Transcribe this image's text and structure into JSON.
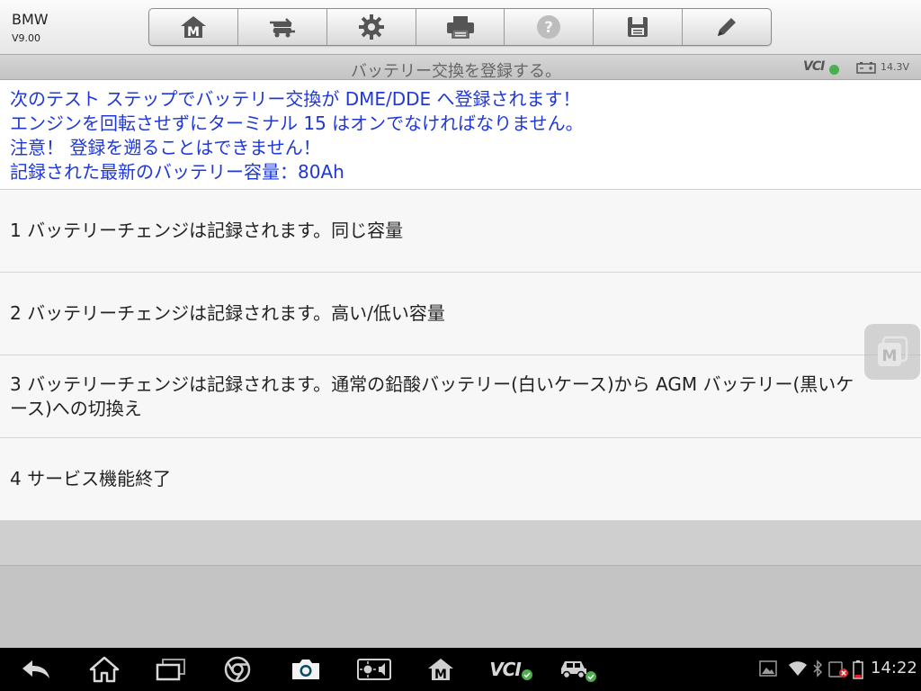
{
  "app": {
    "title": "BMW",
    "version": "V9.00"
  },
  "toolbar": {
    "buttons": [
      {
        "icon": "home-m-icon"
      },
      {
        "icon": "vehicle-swap-icon"
      },
      {
        "icon": "gear-icon"
      },
      {
        "icon": "printer-icon"
      },
      {
        "icon": "help-icon"
      },
      {
        "icon": "save-icon"
      },
      {
        "icon": "pencil-icon"
      }
    ]
  },
  "titlebar": {
    "title": "バッテリー交換を登録する。",
    "vci_label": "VCI",
    "voltage": "14.3V"
  },
  "info": {
    "lines": [
      "次のテスト ステップでバッテリー交換が DME/DDE へ登録されます！",
      "エンジンを回転させずにターミナル 15 はオンでなければなりません。",
      "注意！ 登録を遡ることはできません！",
      "記録された最新のバッテリー容量：80Ah"
    ],
    "color": "#1f38d6"
  },
  "options": [
    "1 バッテリーチェンジは記録されます。同じ容量",
    "2 バッテリーチェンジは記録されます。高い/低い容量",
    "3 バッテリーチェンジは記録されます。通常の鉛酸バッテリー(白いケース)から AGM バッテリー(黒いケース)への切換え",
    "4 サービス機能終了"
  ],
  "navbar": {
    "vci_label": "VCI",
    "time": "14:22"
  }
}
